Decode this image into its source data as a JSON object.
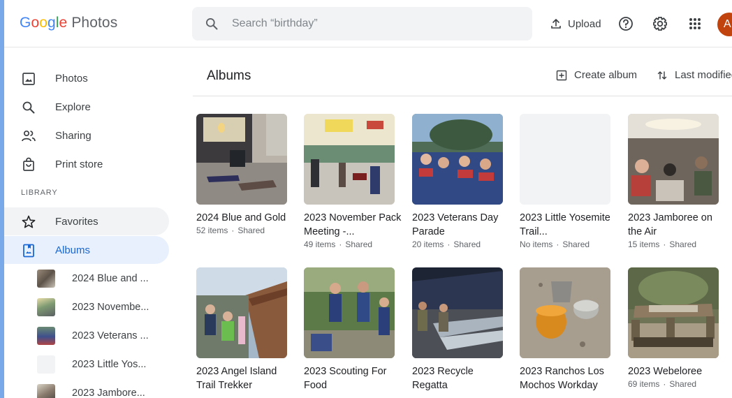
{
  "app": {
    "logo_letters": [
      "G",
      "o",
      "o",
      "g",
      "l",
      "e"
    ],
    "product": "Photos"
  },
  "search": {
    "placeholder": "Search “birthday”"
  },
  "header": {
    "upload_label": "Upload",
    "help_icon": "help-icon",
    "settings_icon": "gear-icon",
    "apps_icon": "apps-grid-icon",
    "avatar_letter": "A",
    "avatar_color": "#c1440e"
  },
  "sidebar": {
    "nav": [
      {
        "label": "Photos",
        "icon": "photo-icon"
      },
      {
        "label": "Explore",
        "icon": "search-icon"
      },
      {
        "label": "Sharing",
        "icon": "people-icon"
      },
      {
        "label": "Print store",
        "icon": "shopping-bag-icon"
      }
    ],
    "library_label": "LIBRARY",
    "library": [
      {
        "label": "Favorites",
        "icon": "star-icon"
      },
      {
        "label": "Albums",
        "icon": "album-icon"
      }
    ],
    "albums": [
      {
        "label": "2024 Blue and ..."
      },
      {
        "label": "2023 Novembe..."
      },
      {
        "label": "2023 Veterans ..."
      },
      {
        "label": "2023 Little Yos..."
      },
      {
        "label": "2023 Jambore..."
      }
    ]
  },
  "main": {
    "title": "Albums",
    "create_label": "Create album",
    "sort_label": "Last modified",
    "albums": [
      {
        "title": "2024 Blue and Gold",
        "items": "52 items",
        "shared": "Shared"
      },
      {
        "title": "2023 November Pack Meeting -...",
        "items": "49 items",
        "shared": "Shared"
      },
      {
        "title": "2023 Veterans Day Parade",
        "items": "20 items",
        "shared": "Shared"
      },
      {
        "title": "2023 Little Yosemite Trail...",
        "items": "No items",
        "shared": "Shared"
      },
      {
        "title": "2023 Jamboree on the Air",
        "items": "15 items",
        "shared": "Shared"
      },
      {
        "title": "2023 Angel Island Trail Trekker",
        "items": "",
        "shared": ""
      },
      {
        "title": "2023 Scouting For Food",
        "items": "",
        "shared": ""
      },
      {
        "title": "2023 Recycle Regatta",
        "items": "",
        "shared": ""
      },
      {
        "title": "2023 Ranchos Los Mochos Workday",
        "items": "",
        "shared": ""
      },
      {
        "title": "2023 Webeloree",
        "items": "69 items",
        "shared": "Shared"
      }
    ]
  },
  "colors": {
    "accent": "#1967d2",
    "active_bg": "#e8f0fe",
    "hover_bg": "#f1f3f4"
  }
}
